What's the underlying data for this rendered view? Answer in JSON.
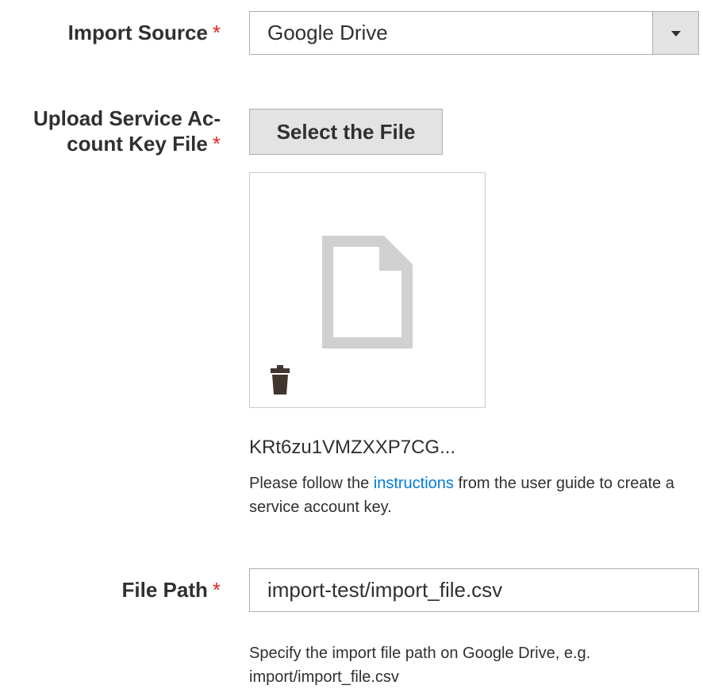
{
  "import_source": {
    "label": "Import Source",
    "required_marker": "*",
    "selected_value": "Google Drive"
  },
  "upload_key_file": {
    "label_line1": "Upload Service Ac-",
    "label_line2": "count Key File",
    "required_marker": "*",
    "button_label": "Select the File",
    "file_name": "KRt6zu1VMZXXP7CG...",
    "note_before_link": "Please follow the ",
    "note_link": "instructions",
    "note_after_link": " from the user guide to create a service account key."
  },
  "file_path": {
    "label": "File Path",
    "required_marker": "*",
    "value": "import-test/import_file.csv",
    "note": "Specify the import file path on Google Drive, e.g. import/import_file.csv"
  },
  "colors": {
    "required": "#e22626",
    "link": "#007bdb",
    "button_bg": "#e3e3e3",
    "icon_grey": "#d0d0d0",
    "trash": "#41362f"
  },
  "icons": {
    "select_arrow": "chevron-down-icon",
    "file_preview": "document-icon",
    "delete": "trash-icon"
  }
}
